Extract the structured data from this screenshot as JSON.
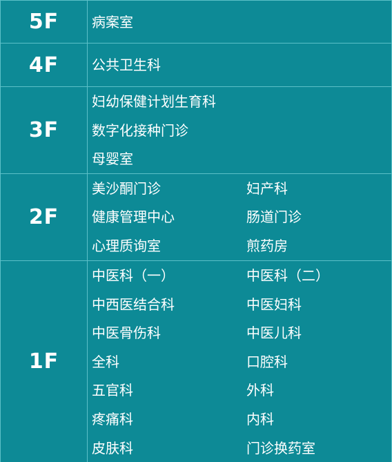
{
  "floors": [
    {
      "label": "5F",
      "departments": [
        "病案室"
      ]
    },
    {
      "label": "4F",
      "departments": [
        "公共卫生科"
      ]
    },
    {
      "label": "3F",
      "departments": [
        "妇幼保健计划生育科",
        "数字化接种门诊",
        "母婴室"
      ]
    },
    {
      "label": "2F",
      "departments": [
        "美沙酮门诊",
        "妇产科",
        "健康管理中心",
        "肠道门诊",
        "心理质询室",
        "煎药房"
      ]
    },
    {
      "label": "1F",
      "departments": [
        "中医科（一）",
        "中医科（二）",
        "中西医结合科",
        "中医妇科",
        "中医骨伤科",
        "中医儿科",
        "全科",
        "口腔科",
        "五官科",
        "外科",
        "疼痛科",
        "内科",
        "皮肤科",
        "门诊换药室"
      ]
    }
  ]
}
